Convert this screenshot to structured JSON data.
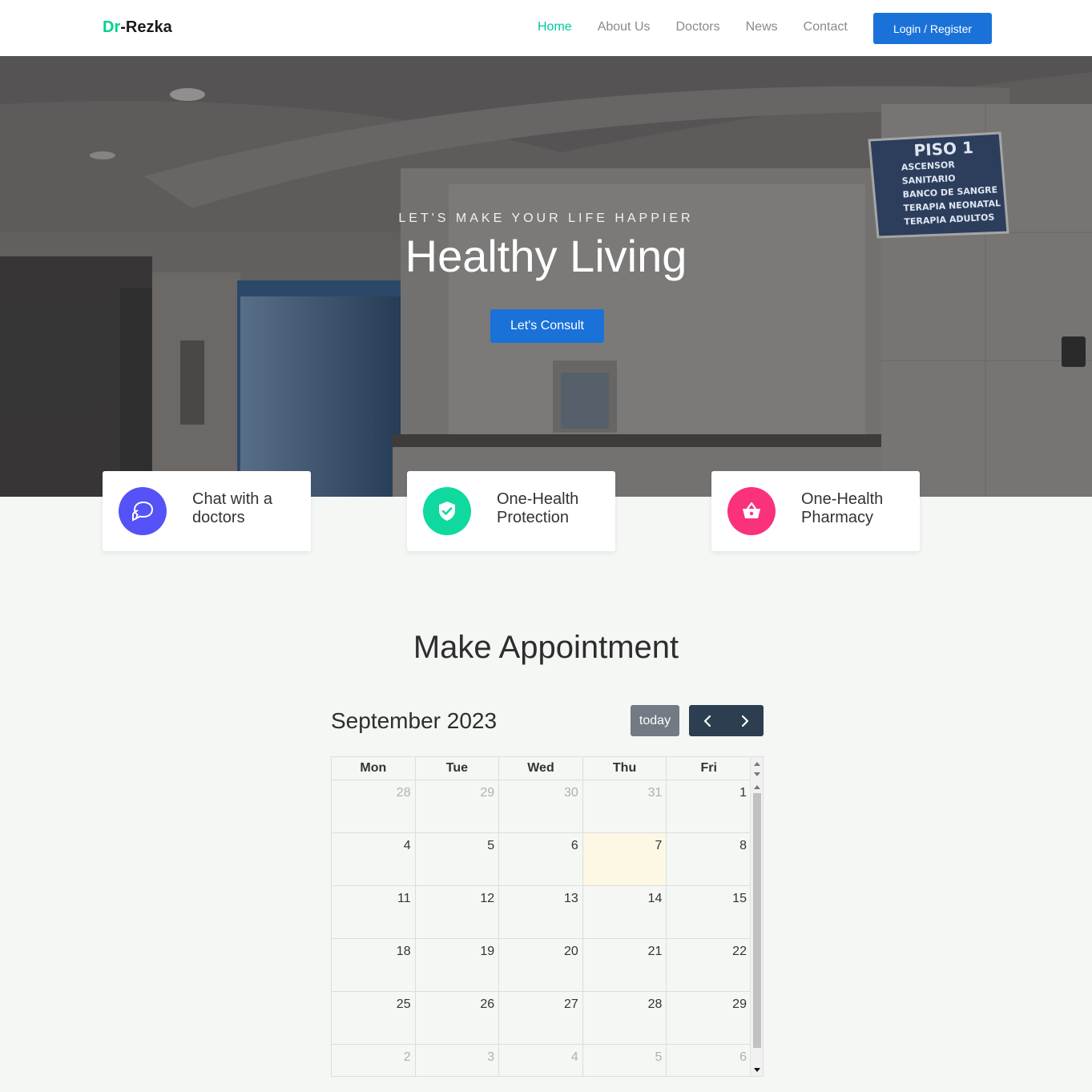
{
  "navbar": {
    "brand_accent": "Dr",
    "brand_rest": "-Rezka",
    "links": [
      "Home",
      "About Us",
      "Doctors",
      "News",
      "Contact"
    ],
    "active_link": "Home",
    "login_label": "Login / Register"
  },
  "hero": {
    "subtitle": "LET'S MAKE YOUR LIFE HAPPIER",
    "title": "Healthy Living",
    "cta_label": "Let's Consult",
    "sign": {
      "heading": "PISO 1",
      "lines": [
        "ASCENSOR",
        "SANITARIO",
        "BANCO DE SANGRE",
        "TERAPIA NEONATAL",
        "TERAPIA ADULTOS"
      ]
    }
  },
  "features": [
    {
      "label": "Chat with a doctors",
      "icon": "chat-icon",
      "color": "#5552f7"
    },
    {
      "label": "One-Health Protection",
      "icon": "shield-check-icon",
      "color": "#0fd99f"
    },
    {
      "label": "One-Health Pharmacy",
      "icon": "basket-icon",
      "color": "#f9327b"
    }
  ],
  "appointment": {
    "title": "Make Appointment",
    "calendar": {
      "month_label": "September 2023",
      "today_label": "today",
      "weekdays": [
        "Mon",
        "Tue",
        "Wed",
        "Thu",
        "Fri"
      ],
      "weeks": [
        [
          {
            "d": "28",
            "other": true
          },
          {
            "d": "29",
            "other": true
          },
          {
            "d": "30",
            "other": true
          },
          {
            "d": "31",
            "other": true
          },
          {
            "d": "1"
          }
        ],
        [
          {
            "d": "4"
          },
          {
            "d": "5"
          },
          {
            "d": "6"
          },
          {
            "d": "7",
            "today": true
          },
          {
            "d": "8"
          }
        ],
        [
          {
            "d": "11"
          },
          {
            "d": "12"
          },
          {
            "d": "13"
          },
          {
            "d": "14"
          },
          {
            "d": "15"
          }
        ],
        [
          {
            "d": "18"
          },
          {
            "d": "19"
          },
          {
            "d": "20"
          },
          {
            "d": "21"
          },
          {
            "d": "22"
          }
        ],
        [
          {
            "d": "25"
          },
          {
            "d": "26"
          },
          {
            "d": "27"
          },
          {
            "d": "28"
          },
          {
            "d": "29"
          }
        ],
        [
          {
            "d": "2",
            "other": true
          },
          {
            "d": "3",
            "other": true
          },
          {
            "d": "4",
            "other": true
          },
          {
            "d": "5",
            "other": true
          },
          {
            "d": "6",
            "other": true
          }
        ]
      ]
    }
  },
  "colors": {
    "brand_accent": "#00d289",
    "active_nav": "#00c9a0",
    "primary": "#1a72d8",
    "today_highlight": "#fcf8e3"
  }
}
